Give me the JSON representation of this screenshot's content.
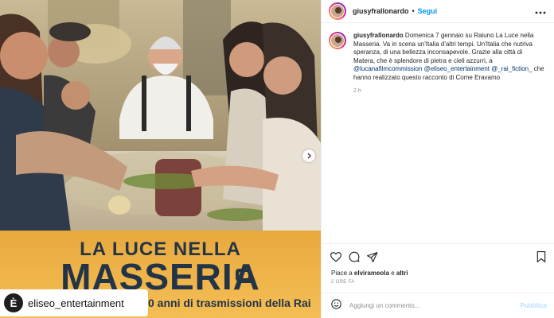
{
  "post": {
    "media": {
      "poster_title_line1": "LA LUCE NELLA",
      "poster_title_line2": "MASSERIA",
      "poster_tagline": "0 anni di trasmissioni della Rai",
      "repost_account": "eliseo_entertainment",
      "repost_logo_letter": "È",
      "next_icon": "chevron-right-icon"
    },
    "header": {
      "username": "giusyfrallonardo",
      "separator": "•",
      "follow_label": "Segui",
      "more_icon": "more-horizontal-icon"
    },
    "caption": {
      "username": "giusyfrallonardo",
      "text_1": "Domenica 7 gennaio su Raiuno La Luce nella Masseria. Va in scena un'Italia d'altri tempi. Un'Italia che nutriva speranza, di una bellezza inconsapevole. Grazie alla città di Matera, che è splendore di pietra e cieli azzurri, a",
      "mention_1": "@lucanafilmcommission",
      "mention_2": "@eliseo_entertainment",
      "mention_3": "@_rai_fiction_",
      "text_2": "che hanno realizzato questo racconto di Come Eravamo",
      "time": "2 h"
    },
    "actions": {
      "like_icon": "heart-icon",
      "comment_icon": "comment-icon",
      "share_icon": "send-icon",
      "save_icon": "bookmark-icon",
      "likes_prefix": "Piace a",
      "likes_user": "elvirameola",
      "likes_connector": "e",
      "likes_others": "altri",
      "time_ago": "2 ORE FA"
    },
    "comment_box": {
      "emoji_icon": "smiley-icon",
      "placeholder": "Aggiungi un commento...",
      "publish_label": "Pubblica"
    },
    "colors": {
      "accent_blue": "#0095f6",
      "publish_disabled": "#b2dffc",
      "poster_text": "#233447",
      "poster_band": "#f0b246"
    }
  }
}
